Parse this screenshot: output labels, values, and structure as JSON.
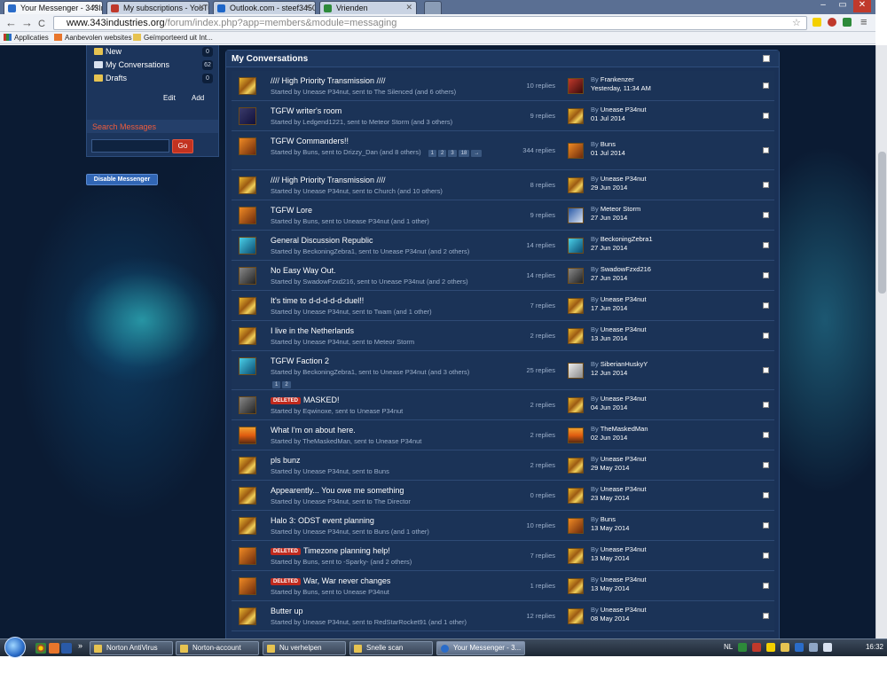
{
  "tabs": [
    {
      "label": "Your Messenger - 343Indu",
      "active": true,
      "icon": "spinner-icon"
    },
    {
      "label": "My subscriptions - YouTu",
      "active": false,
      "icon": "youtube-icon"
    },
    {
      "label": "Outlook.com - steef3450",
      "active": false,
      "icon": "outlook-icon"
    },
    {
      "label": "Vrienden",
      "active": false,
      "icon": "xbox-icon"
    }
  ],
  "window_buttons": {
    "minimize": "–",
    "restore": "▭",
    "close": "✕"
  },
  "nav": {
    "back": "←",
    "forward": "→",
    "reload": "C",
    "menu": "≡"
  },
  "url": {
    "host": "www.343industries.org",
    "path": "/forum/index.php?app=members&module=messaging"
  },
  "bookmarks": {
    "apps": "Applicaties",
    "items": [
      "Aanbevolen websites",
      "Geïmporteerd uit Int..."
    ]
  },
  "sidebar": {
    "folders": [
      {
        "label": "New",
        "count": "0"
      },
      {
        "label": "My Conversations",
        "count": "62"
      },
      {
        "label": "Drafts",
        "count": "0"
      }
    ],
    "edit": "Edit",
    "add": "Add",
    "search_title": "Search Messages",
    "go": "Go",
    "disable": "Disable Messenger"
  },
  "main": {
    "title": "My Conversations",
    "conversations": [
      {
        "title": "//// High Priority Transmission ////",
        "sub": "Started by Unease P34nut, sent to The Silenced (and 6 others)",
        "replies": "10 replies",
        "last_by": "Frankenzer",
        "last_date": "Yesterday, 11:34 AM",
        "deleted": false,
        "pages": []
      },
      {
        "title": "TGFW writer's room",
        "sub": "Started by Ledgend1221, sent to Meteor Storm (and 3 others)",
        "replies": "9 replies",
        "last_by": "Unease P34nut",
        "last_date": "01 Jul 2014",
        "deleted": false,
        "pages": []
      },
      {
        "title": "TGFW Commanders!!",
        "sub": "Started by Buns, sent to Drizzy_Dan (and 8 others)",
        "replies": "344 replies",
        "last_by": "Buns",
        "last_date": "01 Jul 2014",
        "deleted": false,
        "pages": [
          "1",
          "2",
          "3",
          "18",
          "→"
        ]
      },
      {
        "title": "//// High Priority Transmission ////",
        "sub": "Started by Unease P34nut, sent to Church (and 10 others)",
        "replies": "8 replies",
        "last_by": "Unease P34nut",
        "last_date": "29 Jun 2014",
        "deleted": false,
        "pages": []
      },
      {
        "title": "TGFW Lore",
        "sub": "Started by Buns, sent to Unease P34nut (and 1 other)",
        "replies": "9 replies",
        "last_by": "Meteor Storm",
        "last_date": "27 Jun 2014",
        "deleted": false,
        "pages": []
      },
      {
        "title": "General Discussion Republic",
        "sub": "Started by BeckoningZebra1, sent to Unease P34nut (and 2 others)",
        "replies": "14 replies",
        "last_by": "BeckoningZebra1",
        "last_date": "27 Jun 2014",
        "deleted": false,
        "pages": []
      },
      {
        "title": "No Easy Way Out.",
        "sub": "Started by SwadowFzxd216, sent to Unease P34nut (and 2 others)",
        "replies": "14 replies",
        "last_by": "SwadowFzxd216",
        "last_date": "27 Jun 2014",
        "deleted": false,
        "pages": []
      },
      {
        "title": "It's time to d-d-d-d-d-duel!!",
        "sub": "Started by Unease P34nut, sent to Twam (and 1 other)",
        "replies": "7 replies",
        "last_by": "Unease P34nut",
        "last_date": "17 Jun 2014",
        "deleted": false,
        "pages": []
      },
      {
        "title": "I live in the Netherlands",
        "sub": "Started by Unease P34nut, sent to Meteor Storm",
        "replies": "2 replies",
        "last_by": "Unease P34nut",
        "last_date": "13 Jun 2014",
        "deleted": false,
        "pages": []
      },
      {
        "title": "TGFW Faction 2",
        "sub": "Started by BeckoningZebra1, sent to Unease P34nut (and 3 others)",
        "replies": "25 replies",
        "last_by": "SiberianHuskyY",
        "last_date": "12 Jun 2014",
        "deleted": false,
        "pages": [
          "1",
          "2"
        ]
      },
      {
        "title": "MASKED!",
        "sub": "Started by Eqwinoxe, sent to Unease P34nut",
        "replies": "2 replies",
        "last_by": "Unease P34nut",
        "last_date": "04 Jun 2014",
        "deleted": true,
        "pages": []
      },
      {
        "title": "What I'm on about here.",
        "sub": "Started by TheMaskedMan, sent to Unease P34nut",
        "replies": "2 replies",
        "last_by": "TheMaskedMan",
        "last_date": "02 Jun 2014",
        "deleted": false,
        "pages": []
      },
      {
        "title": "pls bunz",
        "sub": "Started by Unease P34nut, sent to Buns",
        "replies": "2 replies",
        "last_by": "Unease P34nut",
        "last_date": "29 May 2014",
        "deleted": false,
        "pages": []
      },
      {
        "title": "Appearently... You owe me something",
        "sub": "Started by Unease P34nut, sent to The Director",
        "replies": "0 replies",
        "last_by": "Unease P34nut",
        "last_date": "23 May 2014",
        "deleted": false,
        "pages": []
      },
      {
        "title": "Halo 3: ODST event planning",
        "sub": "Started by Unease P34nut, sent to Buns (and 1 other)",
        "replies": "10 replies",
        "last_by": "Buns",
        "last_date": "13 May 2014",
        "deleted": false,
        "pages": []
      },
      {
        "title": "Timezone planning help!",
        "sub": "Started by Buns, sent to -Sparky- (and 2 others)",
        "replies": "7 replies",
        "last_by": "Unease P34nut",
        "last_date": "13 May 2014",
        "deleted": true,
        "pages": []
      },
      {
        "title": "War, War never changes",
        "sub": "Started by Buns, sent to Unease P34nut",
        "replies": "1 replies",
        "last_by": "Unease P34nut",
        "last_date": "13 May 2014",
        "deleted": true,
        "pages": []
      },
      {
        "title": "Butter up",
        "sub": "Started by Unease P34nut, sent to RedStarRocket91 (and 1 other)",
        "replies": "12 replies",
        "last_by": "Unease P34nut",
        "last_date": "08 May 2014",
        "deleted": false,
        "pages": []
      }
    ],
    "deleted_badge": "DELETED",
    "by_prefix": "By"
  },
  "taskbar": {
    "tasks": [
      {
        "label": "Norton AntiVirus",
        "active": false
      },
      {
        "label": "Norton-account",
        "active": false
      },
      {
        "label": "Nu verhelpen",
        "active": false
      },
      {
        "label": "Snelle scan",
        "active": false
      },
      {
        "label": "Your Messenger - 3...",
        "active": true
      }
    ],
    "lang": "NL",
    "clock": "16:32"
  }
}
